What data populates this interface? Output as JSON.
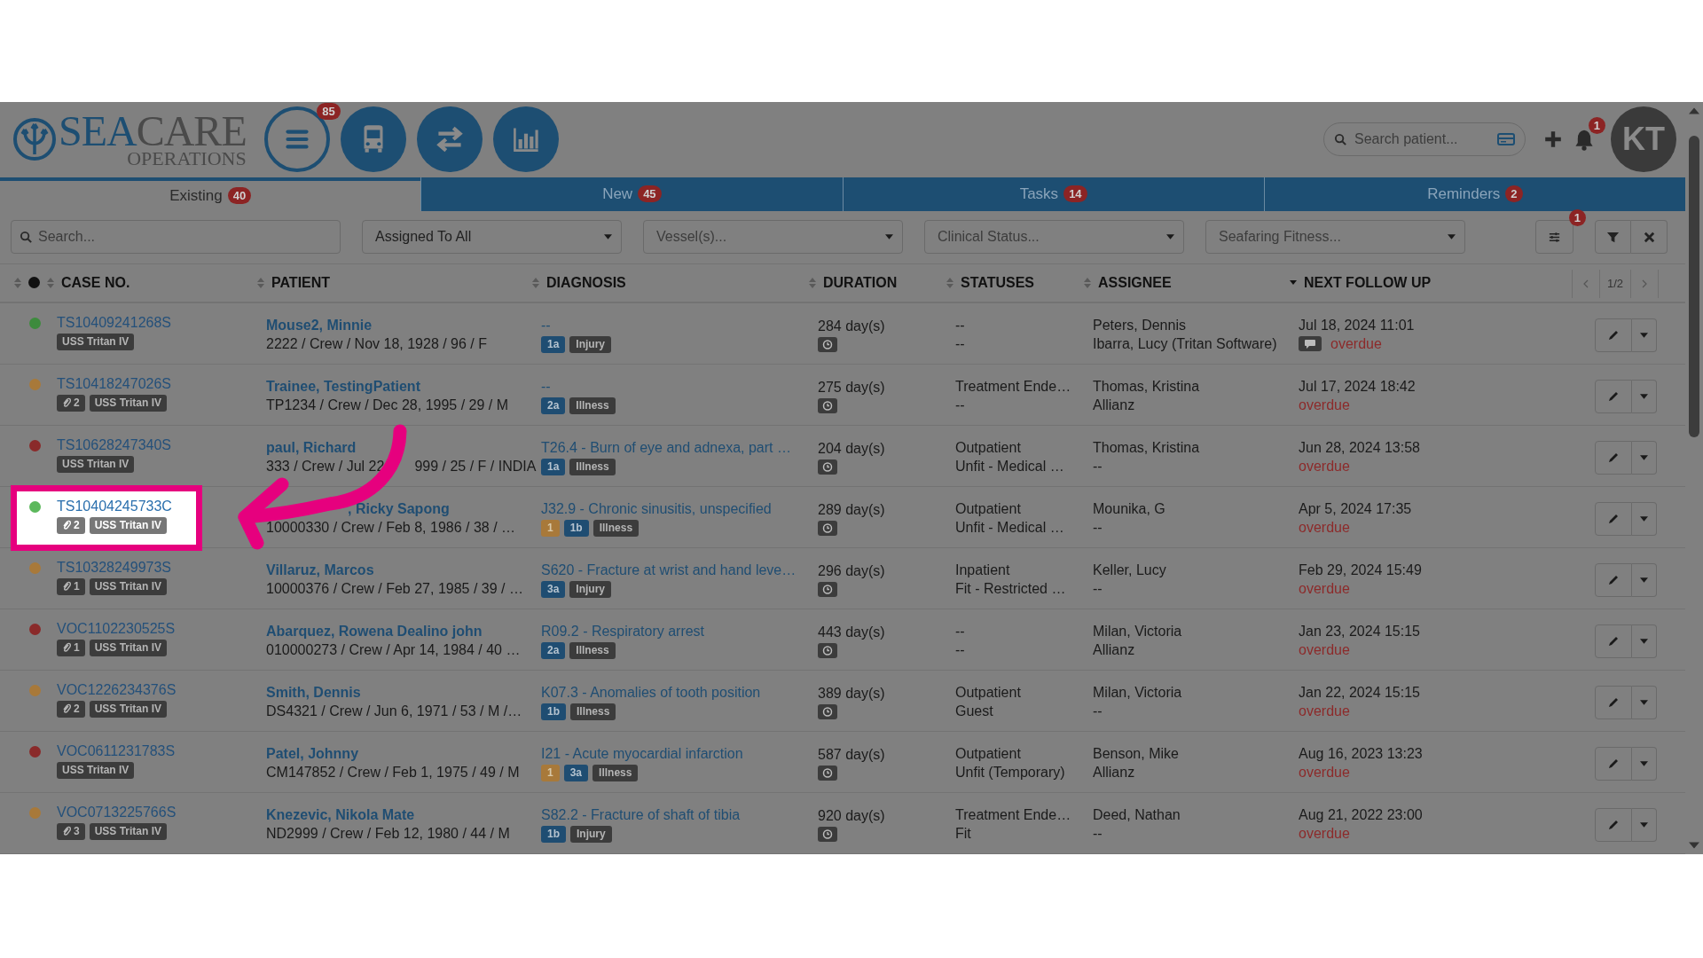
{
  "header": {
    "logo": {
      "primary": "SEA",
      "secondary": "CARE",
      "subtitle": "OPERATIONS"
    },
    "menu_badge": "85",
    "search": {
      "placeholder": "Search patient..."
    },
    "bell_badge": "1",
    "avatar": "KT"
  },
  "tabs": [
    {
      "label": "Existing",
      "count": "40",
      "selected": true
    },
    {
      "label": "New",
      "count": "45",
      "selected": false
    },
    {
      "label": "Tasks",
      "count": "14",
      "selected": false
    },
    {
      "label": "Reminders",
      "count": "2",
      "selected": false
    }
  ],
  "filters": {
    "search": {
      "placeholder": "Search..."
    },
    "dropdowns": [
      {
        "value": "Assigned To All",
        "kind": "value"
      },
      {
        "value": "Vessel(s)...",
        "kind": "placeholder"
      },
      {
        "value": "Clinical Status...",
        "kind": "placeholder"
      },
      {
        "value": "Seafaring Fitness...",
        "kind": "placeholder"
      }
    ],
    "settings_badge": "1"
  },
  "table": {
    "columns": [
      {
        "label": "CASE NO.",
        "sorted": false
      },
      {
        "label": "PATIENT",
        "sorted": false
      },
      {
        "label": "DIAGNOSIS",
        "sorted": false
      },
      {
        "label": "DURATION",
        "sorted": false
      },
      {
        "label": "STATUSES",
        "sorted": false
      },
      {
        "label": "ASSIGNEE",
        "sorted": false
      },
      {
        "label": "NEXT FOLLOW UP",
        "sorted": true
      }
    ],
    "pagination": "1/2",
    "rows": [
      {
        "color": "#3d8b3d",
        "highlighted": false,
        "case_no": "TS10409241268S",
        "tags": [
          {
            "kind": "vessel",
            "text": "USS Tritan IV"
          }
        ],
        "patient": "Mouse2, Minnie",
        "details": "2222 / Crew / Nov 18, 1928 / 96 / F",
        "diagnosis": "--",
        "badges": [
          {
            "kind": "level",
            "text": "1a"
          },
          {
            "kind": "type",
            "text": "Injury"
          }
        ],
        "duration": "284 day(s)",
        "statuses": [
          "--",
          "--"
        ],
        "assignees": [
          "Peters, Dennis",
          "Ibarra, Lucy (Tritan Software)"
        ],
        "follow_up": "Jul 18, 2024 11:01",
        "comment": true,
        "overdue": "overdue"
      },
      {
        "color": "#a8793a",
        "highlighted": false,
        "case_no": "TS10418247026S",
        "tags": [
          {
            "kind": "attachments",
            "text": "2"
          },
          {
            "kind": "vessel",
            "text": "USS Tritan IV"
          }
        ],
        "patient": "Trainee, TestingPatient",
        "details": "TP1234 / Crew / Dec 28, 1995 / 29 / M",
        "diagnosis": "--",
        "badges": [
          {
            "kind": "level",
            "text": "2a"
          },
          {
            "kind": "type",
            "text": "Illness"
          }
        ],
        "duration": "275 day(s)",
        "statuses": [
          "Treatment Ende…",
          "--"
        ],
        "assignees": [
          "Thomas, Kristina",
          "Allianz"
        ],
        "follow_up": "Jul 17, 2024 18:42",
        "comment": false,
        "overdue": "overdue"
      },
      {
        "color": "#8a2a2a",
        "highlighted": false,
        "case_no": "TS10628247340S",
        "tags": [
          {
            "kind": "vessel",
            "text": "USS Tritan IV"
          }
        ],
        "patient": "paul, Richard",
        "details": "333 / Crew / Jul 22",
        "details_after": "999 / 25 / F / INDIA",
        "diagnosis": "T26.4 - Burn of eye and adnexa, part …",
        "badges": [
          {
            "kind": "level",
            "text": "1a"
          },
          {
            "kind": "type",
            "text": "Illness"
          }
        ],
        "duration": "204 day(s)",
        "statuses": [
          "Outpatient",
          "Unfit - Medical …"
        ],
        "assignees": [
          "Thomas, Kristina",
          "--"
        ],
        "follow_up": "Jun 28, 2024 13:58",
        "comment": false,
        "overdue": "overdue"
      },
      {
        "color": "#5cb85c",
        "highlighted": true,
        "case_no": "TS10404245733C",
        "tags": [
          {
            "kind": "attachments",
            "text": "2"
          },
          {
            "kind": "vessel",
            "text": "USS Tritan IV"
          }
        ],
        "patient": ", Ricky Sapong",
        "details": "10000330 / Crew / Feb 8, 1986 / 38 / …",
        "diagnosis": "J32.9 - Chronic sinusitis, unspecified",
        "badges": [
          {
            "kind": "priority",
            "text": "1"
          },
          {
            "kind": "level",
            "text": "1b"
          },
          {
            "kind": "type",
            "text": "Illness"
          }
        ],
        "duration": "289 day(s)",
        "statuses": [
          "Outpatient",
          "Unfit - Medical …"
        ],
        "assignees": [
          "Mounika, G",
          "--"
        ],
        "follow_up": "Apr 5, 2024 17:35",
        "comment": false,
        "overdue": "overdue"
      },
      {
        "color": "#a8793a",
        "highlighted": false,
        "case_no": "TS10328249973S",
        "tags": [
          {
            "kind": "attachments",
            "text": "1"
          },
          {
            "kind": "vessel",
            "text": "USS Tritan IV"
          }
        ],
        "patient": "Villaruz, Marcos",
        "details": "10000376 / Crew / Feb 27, 1985 / 39 / …",
        "diagnosis": "S620 - Fracture at wrist and hand leve…",
        "badges": [
          {
            "kind": "level",
            "text": "3a"
          },
          {
            "kind": "type",
            "text": "Injury"
          }
        ],
        "duration": "296 day(s)",
        "statuses": [
          "Inpatient",
          "Fit - Restricted …"
        ],
        "assignees": [
          "Keller, Lucy",
          "--"
        ],
        "follow_up": "Feb 29, 2024 15:49",
        "comment": false,
        "overdue": "overdue"
      },
      {
        "color": "#8a2a2a",
        "highlighted": false,
        "case_no": "VOC1102230525S",
        "tags": [
          {
            "kind": "attachments",
            "text": "1"
          },
          {
            "kind": "vessel",
            "text": "USS Tritan IV"
          }
        ],
        "patient": "Abarquez, Rowena Dealino john",
        "details": "010000273 / Crew / Apr 14, 1984 / 40 …",
        "diagnosis": "R09.2 - Respiratory arrest",
        "badges": [
          {
            "kind": "level",
            "text": "2a"
          },
          {
            "kind": "type",
            "text": "Illness"
          }
        ],
        "duration": "443 day(s)",
        "statuses": [
          "--",
          "--"
        ],
        "assignees": [
          "Milan, Victoria",
          "Allianz"
        ],
        "follow_up": "Jan 23, 2024 15:15",
        "comment": false,
        "overdue": "overdue"
      },
      {
        "color": "#a8793a",
        "highlighted": false,
        "case_no": "VOC1226234376S",
        "tags": [
          {
            "kind": "attachments",
            "text": "2"
          },
          {
            "kind": "vessel",
            "text": "USS Tritan IV"
          }
        ],
        "patient": "Smith, Dennis",
        "details": "DS4321 / Crew / Jun 6, 1971 / 53 / M /…",
        "diagnosis": "K07.3 - Anomalies of tooth position",
        "badges": [
          {
            "kind": "level",
            "text": "1b"
          },
          {
            "kind": "type",
            "text": "Illness"
          }
        ],
        "duration": "389 day(s)",
        "statuses": [
          "Outpatient",
          "Guest"
        ],
        "assignees": [
          "Milan, Victoria",
          "--"
        ],
        "follow_up": "Jan 22, 2024 15:15",
        "comment": false,
        "overdue": "overdue"
      },
      {
        "color": "#8a2a2a",
        "highlighted": false,
        "case_no": "VOC0611231783S",
        "tags": [
          {
            "kind": "vessel",
            "text": "USS Tritan IV"
          }
        ],
        "patient": "Patel, Johnny",
        "details": "CM147852 / Crew / Feb 1, 1975 / 49 / M",
        "diagnosis": "I21 - Acute myocardial infarction",
        "badges": [
          {
            "kind": "priority",
            "text": "1"
          },
          {
            "kind": "level",
            "text": "3a"
          },
          {
            "kind": "type",
            "text": "Illness"
          }
        ],
        "duration": "587 day(s)",
        "statuses": [
          "Outpatient",
          "Unfit (Temporary)"
        ],
        "assignees": [
          "Benson, Mike",
          "Allianz"
        ],
        "follow_up": "Aug 16, 2023 13:23",
        "comment": false,
        "overdue": "overdue"
      },
      {
        "color": "#a8793a",
        "highlighted": false,
        "case_no": "VOC0713225766S",
        "tags": [
          {
            "kind": "attachments",
            "text": "3"
          },
          {
            "kind": "vessel",
            "text": "USS Tritan IV"
          }
        ],
        "patient": "Knezevic, Nikola Mate",
        "details": "ND2999 / Crew / Feb 12, 1980 / 44 / M",
        "diagnosis": "S82.2 - Fracture of shaft of tibia",
        "badges": [
          {
            "kind": "level",
            "text": "1b"
          },
          {
            "kind": "type",
            "text": "Injury"
          }
        ],
        "duration": "920 day(s)",
        "statuses": [
          "Treatment Ende…",
          "Fit"
        ],
        "assignees": [
          "Deed, Nathan",
          "--"
        ],
        "follow_up": "Aug 21, 2022 23:00",
        "comment": false,
        "overdue": "overdue"
      }
    ]
  }
}
